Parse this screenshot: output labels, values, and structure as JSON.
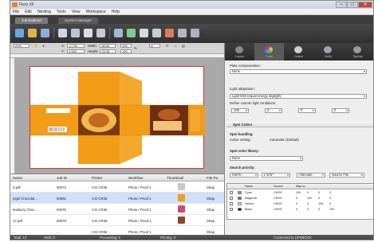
{
  "window": {
    "title": "Fiery XF",
    "min_label": "–",
    "max_label": "□",
    "close_label": "✕"
  },
  "menu": [
    "File",
    "Edit",
    "Nesting",
    "Tools",
    "View",
    "Workspace",
    "Help"
  ],
  "tabs": [
    "Job Explorer",
    "System Manager"
  ],
  "properties_toolbar": {
    "zoom": "20%",
    "x_label": "X:",
    "x_value": "-2.702",
    "y_label": "Y:",
    "y_value": "4.500",
    "width_label": "Width:",
    "width_value": "18.65",
    "height_label": "Height:",
    "height_value": "13.08",
    "scale_w": "100",
    "scale_h": "100",
    "unit": "in"
  },
  "job_list": {
    "columns": [
      "Name",
      "Job ID",
      "Printer",
      "Workflow",
      "Thumbnail",
      "File Pa"
    ],
    "rows": [
      {
        "name": "3.pdf",
        "job_id": "00072",
        "printer": "CXI CR35",
        "workflow": "Photo / Proof 1",
        "file": "Shap"
      },
      {
        "name": "ingel Chocolat...",
        "job_id": "00081",
        "printer": "CXI CR35",
        "workflow": "Photo / Proof 1",
        "file": "Shap"
      },
      {
        "name": "lewberry Choc...",
        "job_id": "00075",
        "printer": "CXI CR35",
        "workflow": "Photo / Proof 1",
        "file": "Shap"
      },
      {
        "name": "17.pdf",
        "job_id": "00079",
        "printer": "CXI CR35",
        "workflow": "Photo / Proof 1",
        "file": "Shap"
      },
      {
        "name": "...",
        "job_id": "...",
        "printer": "CXI CR35",
        "workflow": "Photo / Proof 1",
        "file": "Shap"
      }
    ]
  },
  "panel": {
    "tabs": [
      "Layout",
      "Color",
      "Output",
      "Verify",
      "Special"
    ],
    "plate_compensation_label": "Plate compensation:",
    "plate_compensation_value": "None",
    "light_adaptation_label": "Light adaptation:",
    "light_adaptation_value": "Light D50 (equal energy daylight)",
    "define_custom_label": "Define custom light conditions:",
    "custom_vals": [
      "100",
      "0",
      "0",
      "0"
    ],
    "spot_colors_header": "Spot Colors",
    "spot_handling_label": "Spot handling",
    "active_setting_label": "Active setting:",
    "active_setting_value": "Automatic (Default)",
    "spot_library_label": "Spot color library:",
    "spot_library_value": "None",
    "search_priority_label": "Search priority:",
    "search_priority_values": [
      "CMYK",
      "L*a*b*",
      "Alternate",
      "Source File"
    ],
    "spot_table": {
      "columns": [
        "Name",
        "Source",
        "Map to"
      ],
      "rows": [
        {
          "name": "Cyan",
          "source": "CMYK",
          "vals": [
            "100",
            "0",
            "0",
            "0"
          ],
          "color": "#19b3e6"
        },
        {
          "name": "Magenta",
          "source": "CMYK",
          "vals": [
            "0",
            "100",
            "0",
            "0"
          ],
          "color": "#e61e8c"
        },
        {
          "name": "Yellow",
          "source": "CMYK",
          "vals": [
            "0",
            "0",
            "100",
            "0"
          ],
          "color": "#f4e61a"
        },
        {
          "name": "Black",
          "source": "CMYK",
          "vals": [
            "0",
            "0",
            "0",
            "100"
          ],
          "color": "#111111"
        }
      ]
    }
  },
  "status": {
    "total": "Total: 12",
    "held": "Held: 3",
    "processing": "Processing: 0",
    "printing": "Printing: 0",
    "connected": "Connected to UPSBOOK"
  },
  "colors": {
    "accent": "#f59a12",
    "toolbar": "#3a3a3a",
    "selection": "#cfe0f7"
  }
}
